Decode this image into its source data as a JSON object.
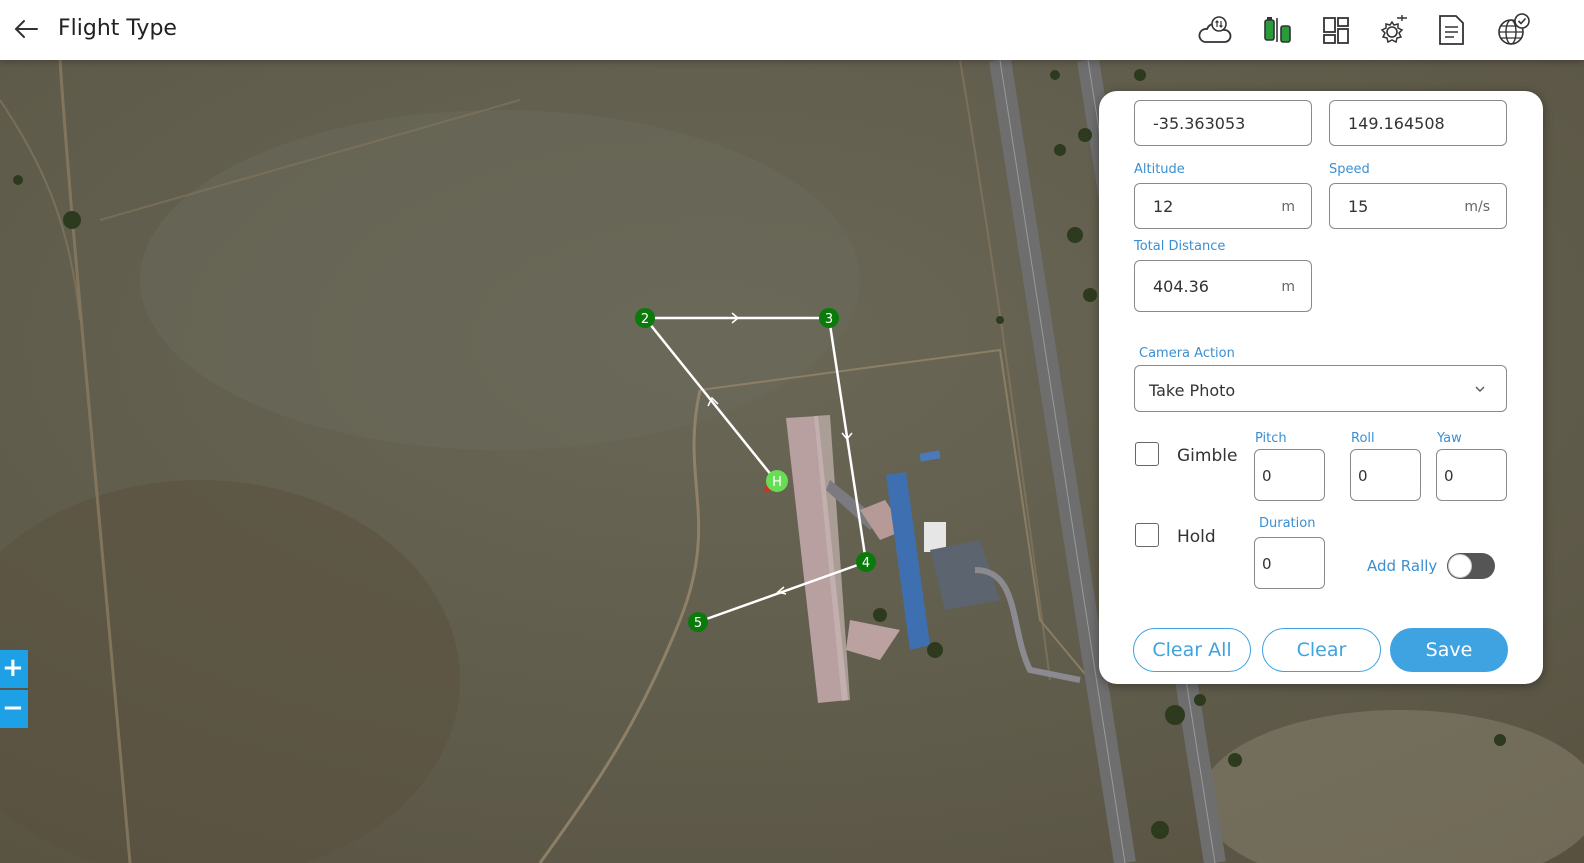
{
  "header": {
    "title": "Flight Type",
    "icons": [
      "back-arrow-icon",
      "cloud-sync-icon",
      "drone-battery-icon",
      "dashboard-layout-icon",
      "drone-settings-icon",
      "document-icon",
      "globe-check-icon"
    ]
  },
  "map": {
    "zoom_in": "+",
    "zoom_out": "−",
    "waypoints": [
      {
        "label": "2"
      },
      {
        "label": "3"
      },
      {
        "label": "4"
      },
      {
        "label": "5"
      },
      {
        "label": "H"
      }
    ]
  },
  "panel": {
    "latitude": "-35.363053",
    "longitude": "149.164508",
    "altitude_label": "Altitude",
    "altitude_value": "12",
    "altitude_unit": "m",
    "speed_label": "Speed",
    "speed_value": "15",
    "speed_unit": "m/s",
    "total_distance_label": "Total Distance",
    "total_distance_value": "404.36",
    "total_distance_unit": "m",
    "camera_action_label": "Camera Action",
    "camera_action_value": "Take Photo",
    "gimble_label": "Gimble",
    "pitch_label": "Pitch",
    "pitch_value": "0",
    "roll_label": "Roll",
    "roll_value": "0",
    "yaw_label": "Yaw",
    "yaw_value": "0",
    "hold_label": "Hold",
    "duration_label": "Duration",
    "duration_value": "0",
    "add_rally_label": "Add Rally",
    "add_rally_on": false,
    "clear_all_label": "Clear All",
    "clear_label": "Clear",
    "save_label": "Save"
  },
  "colors": {
    "accent": "#3ea3e0",
    "waypoint": "#0a7a0a",
    "home": "#66dd55",
    "zoom": "#1ea0e6"
  }
}
